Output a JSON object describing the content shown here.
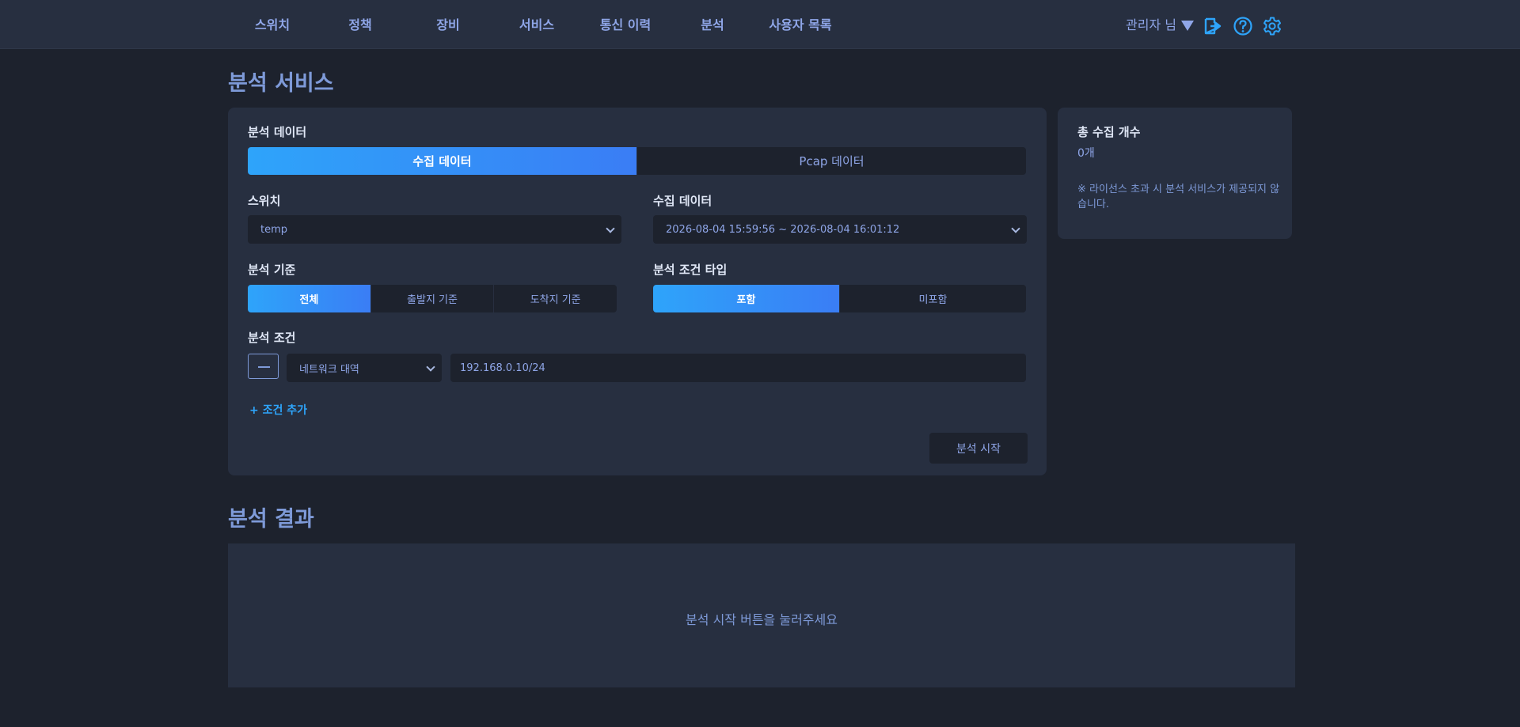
{
  "nav": {
    "items": [
      "스위치",
      "정책",
      "장비",
      "서비스",
      "통신 이력",
      "분석",
      "사용자 목록"
    ],
    "user": "관리자 님"
  },
  "icons": [
    "logout-icon",
    "help-icon",
    "settings-icon"
  ],
  "colors": {
    "accent": "#2ea4fa",
    "accent_end": "#3a7df5",
    "background": "#1d222d",
    "panel": "#272f40",
    "text": "#8fa6e8"
  },
  "page_title": "분석 서비스",
  "analysis": {
    "data_label": "분석 데이터",
    "data_tabs": [
      "수집 데이터",
      "Pcap 데이터"
    ],
    "data_selected": "수집 데이터",
    "switch_label": "스위치",
    "switch_value": "temp",
    "collect_label": "수집 데이터",
    "collect_value": "2026-08-04 15:59:56 ~ 2026-08-04 16:01:12",
    "basis_label": "분석 기준",
    "basis_options": [
      "전체",
      "출발지 기준",
      "도착지 기준"
    ],
    "basis_selected": "전체",
    "cond_type_label": "분석 조건 타입",
    "cond_type_options": [
      "포함",
      "미포함"
    ],
    "cond_type_selected": "포함",
    "cond_label": "분석 조건",
    "cond_field": "네트워크 대역",
    "cond_value": "192.168.0.10/24",
    "add_cond": "+ 조건 추가",
    "start_button": "분석 시작"
  },
  "summary": {
    "title": "총 수집 개수",
    "count": "0개",
    "note": "※ 라이선스 초과 시 분석 서비스가 제공되지 않습니다."
  },
  "result": {
    "title": "분석 결과",
    "placeholder": "분석 시작 버튼을 눌러주세요"
  }
}
